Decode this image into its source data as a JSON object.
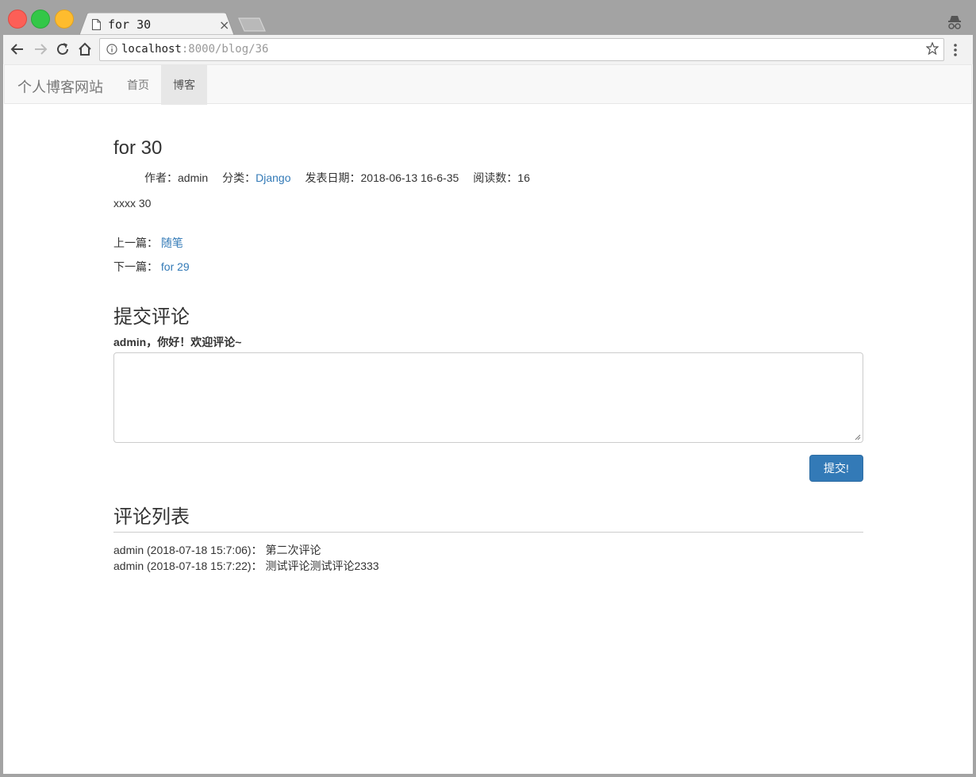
{
  "browser": {
    "tab_title": "for 30",
    "tab_close": "×",
    "url_host": "localhost",
    "url_rest": ":8000/blog/36"
  },
  "navbar": {
    "brand": "个人博客网站",
    "links": [
      {
        "label": "首页",
        "active": false
      },
      {
        "label": "博客",
        "active": true
      }
    ]
  },
  "post": {
    "title": "for 30",
    "author_label": "作者：",
    "author": "admin",
    "category_label": "分类：",
    "category": "Django",
    "date_label": "发表日期：",
    "date": "2018-06-13 16-6-35",
    "reads_label": "阅读数：",
    "reads": "16",
    "content": "xxxx 30",
    "prev_label": "上一篇：",
    "prev_link": "随笔",
    "next_label": "下一篇：",
    "next_link": "for 29"
  },
  "comment_form": {
    "heading": "提交评论",
    "greeting": "admin，你好！欢迎评论~",
    "textarea_value": "",
    "submit_label": "提交!"
  },
  "comment_list": {
    "heading": "评论列表",
    "items": [
      {
        "meta": "admin (2018-07-18 15:7:06)：",
        "text": "第二次评论"
      },
      {
        "meta": "admin (2018-07-18 15:7:22)：",
        "text": "测试评论测试评论2333"
      }
    ]
  },
  "colors": {
    "link": "#337ab7",
    "button": "#337ab7",
    "navbar_bg": "#f8f8f8",
    "active_nav_bg": "#e7e7e7"
  }
}
